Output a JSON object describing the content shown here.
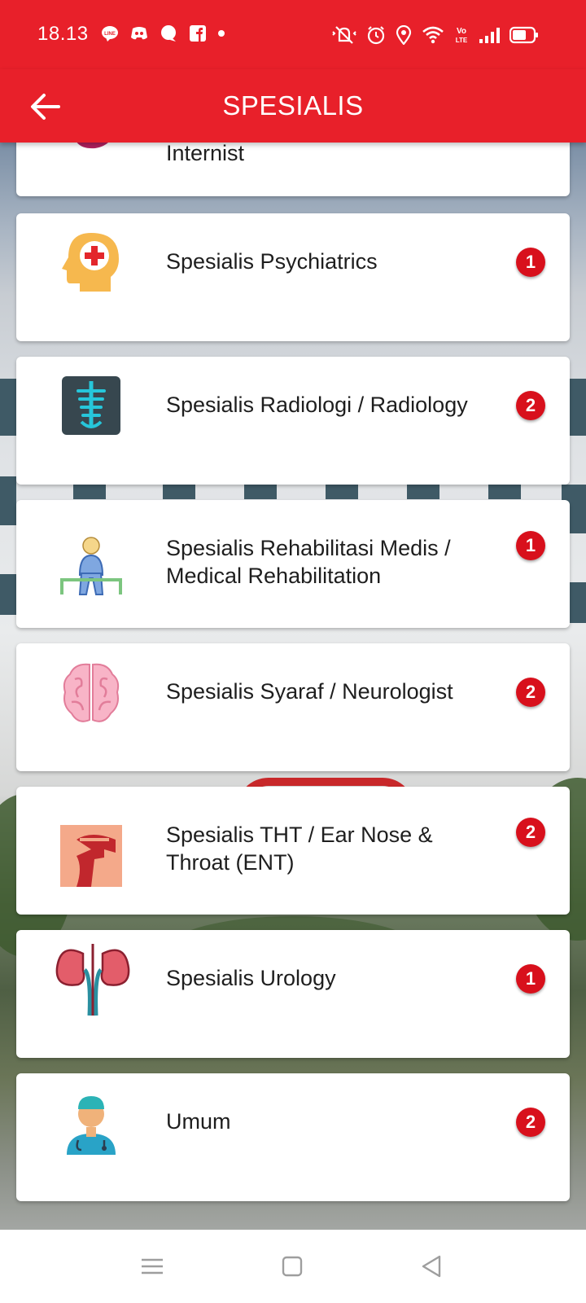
{
  "status_bar": {
    "time": "18.13",
    "left_icons": [
      "line-icon",
      "discord-icon",
      "chat-icon",
      "facebook-icon",
      "dot-icon"
    ],
    "right_icons": [
      "silent-icon",
      "alarm-icon",
      "location-icon",
      "wifi-icon",
      "volte-icon",
      "signal-icon",
      "battery-icon"
    ]
  },
  "app_bar": {
    "title": "SPESIALIS",
    "back_icon": "arrow-left-icon",
    "background": "#e8202a"
  },
  "specialists": [
    {
      "label": "Internist",
      "icon": "kidney-partial-icon",
      "count": ""
    },
    {
      "label": "Spesialis Psychiatrics",
      "icon": "head-medical-icon",
      "count": "1"
    },
    {
      "label": "Spesialis Radiologi / Radiology",
      "icon": "xray-icon",
      "count": "2"
    },
    {
      "label": "Spesialis Rehabilitasi Medis / Medical Rehabilitation",
      "icon": "person-sitting-icon",
      "count": "1"
    },
    {
      "label": "Spesialis Syaraf / Neurologist",
      "icon": "brain-icon",
      "count": "2"
    },
    {
      "label": "Spesialis THT / Ear Nose & Throat (ENT)",
      "icon": "ent-icon",
      "count": "2"
    },
    {
      "label": "Spesialis Urology",
      "icon": "kidneys-icon",
      "count": "1"
    },
    {
      "label": "Umum",
      "icon": "doctor-icon",
      "count": "2"
    }
  ],
  "badge_color": "#d8101c",
  "nav_bar": {
    "icons": [
      "menu-icon",
      "home-square-icon",
      "back-triangle-icon"
    ]
  }
}
